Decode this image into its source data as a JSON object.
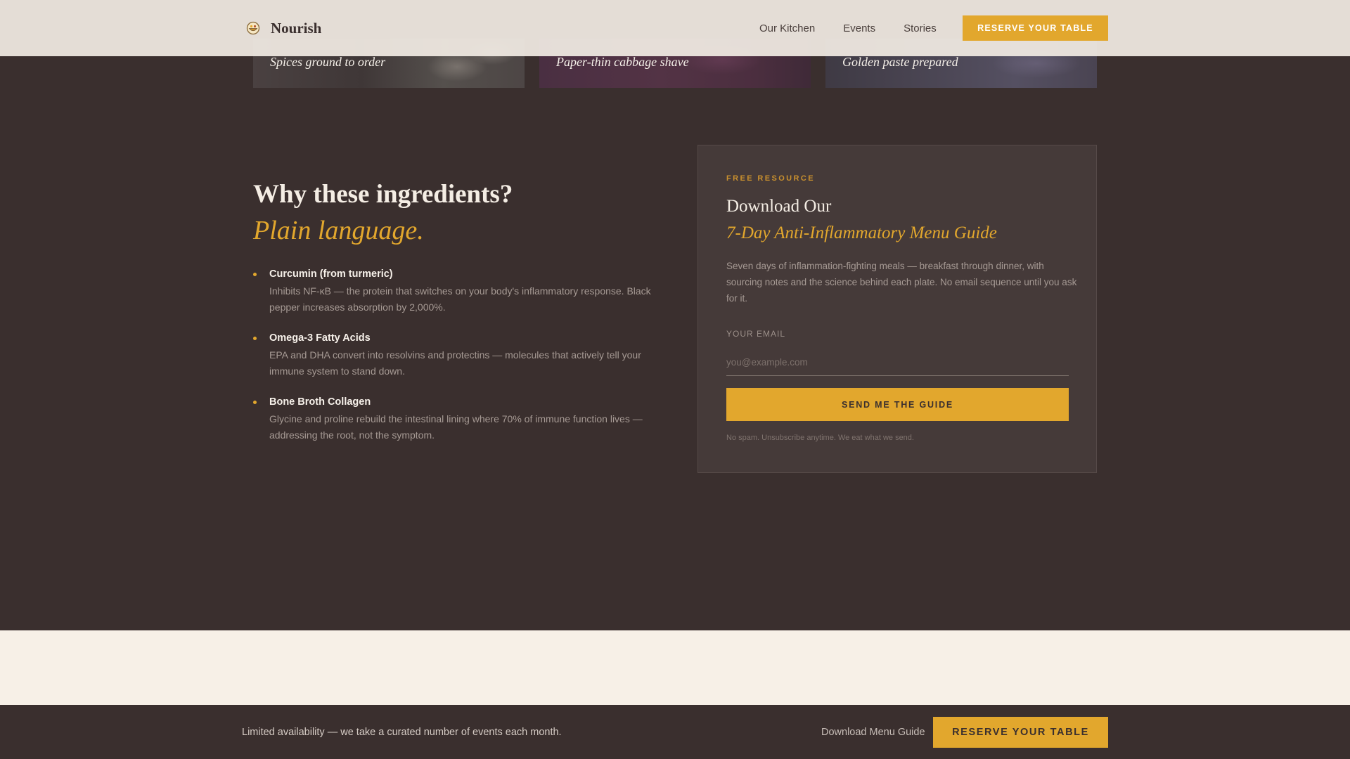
{
  "header": {
    "brand_name": "Nourish",
    "nav": [
      "Our Kitchen",
      "Events",
      "Stories"
    ],
    "cta_label": "RESERVE YOUR TABLE"
  },
  "strip": {
    "captions": [
      "Spices ground to order",
      "Paper-thin cabbage shave",
      "Golden paste prepared"
    ]
  },
  "why": {
    "title": "Why these ingredients?",
    "subtitle": "Plain language.",
    "items": [
      {
        "name": "Curcumin (from turmeric)",
        "desc": "Inhibits NF-κB — the protein that switches on your body's inflammatory response. Black pepper increases absorption by 2,000%."
      },
      {
        "name": "Omega-3 Fatty Acids",
        "desc": "EPA and DHA convert into resolvins and protectins — molecules that actively tell your immune system to stand down."
      },
      {
        "name": "Bone Broth Collagen",
        "desc": "Glycine and proline rebuild the intestinal lining where 70% of immune function lives — addressing the root, not the symptom."
      }
    ]
  },
  "guide": {
    "eyebrow": "FREE RESOURCE",
    "title": "Download Our",
    "title_em": "7-Day Anti-Inflammatory Menu Guide",
    "desc": "Seven days of inflammation-fighting meals — breakfast through dinner, with sourcing notes and the science behind each plate. No email sequence until you ask for it.",
    "email_label": "YOUR EMAIL",
    "email_placeholder": "you@example.com",
    "email_value": "",
    "button_label": "SEND ME THE GUIDE",
    "fine_print": "No spam. Unsubscribe anytime. We eat what we send."
  },
  "footer": {
    "text": "Limited availability — we take a curated number of events each month.",
    "link_label": "Download Menu Guide",
    "cta_label": "RESERVE YOUR TABLE"
  },
  "colors": {
    "accent": "#e2a72d",
    "background": "#3a2f2e",
    "card": "#453a39",
    "header": "#efe9e1",
    "light_band": "#f7f0e7"
  },
  "icons": {
    "brand_logo": "bowl-logo-icon",
    "bullet": "bullet-dot-icon"
  }
}
